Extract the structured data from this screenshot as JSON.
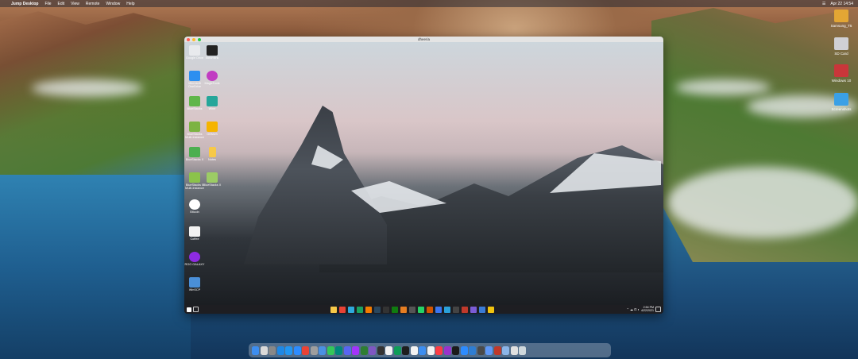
{
  "menubar": {
    "app_name": "Jump Desktop",
    "menus": [
      "File",
      "Edit",
      "View",
      "Remote",
      "Window",
      "Help"
    ],
    "clock": "Apr 22 14:54"
  },
  "desktop_icons": [
    {
      "label": "Samsung_T5",
      "icon": "drive-icon",
      "color": "#e3a634"
    },
    {
      "label": "SD Card",
      "icon": "sd-card-icon",
      "color": "#d0d0d5"
    },
    {
      "label": "Windows 10",
      "icon": "windows-screen-icon",
      "color": "#c9363a"
    },
    {
      "label": "Screenshots",
      "icon": "folder-icon",
      "color": "#3aa0e6"
    }
  ],
  "remote_window": {
    "title": "dheeria",
    "desktop_icons": [
      {
        "label": "Google Drive",
        "icon": "google-drive-icon",
        "color": "#e8eaed"
      },
      {
        "label": "Steamlink",
        "icon": "steamlink-icon",
        "color": "#222"
      },
      {
        "label": "Microsoft OneDrive",
        "icon": "onedrive-icon",
        "color": "#2d8ff0"
      },
      {
        "label": "MagicTools",
        "icon": "magictools-icon",
        "color": "#c13cc2"
      },
      {
        "label": "BlueStacks",
        "icon": "bluestacks-icon",
        "color": "#5fb64a"
      },
      {
        "label": "Wine",
        "icon": "wine-icon",
        "color": "#26a69a"
      },
      {
        "label": "BlueStacks Multi-Instance",
        "icon": "bluestacks-multi-icon",
        "color": "#7cb342"
      },
      {
        "label": "GBNUS",
        "icon": "lightning-icon",
        "color": "#f5b400"
      },
      {
        "label": "BlueStacks X",
        "icon": "bluestacks-x-icon",
        "color": "#4caf50"
      },
      {
        "label": "Notes",
        "icon": "notes-icon",
        "color": "#f7c948"
      },
      {
        "label": "BlueStacks 5 Multi-Instance",
        "icon": "bluestacks5-icon",
        "color": "#8bc34a"
      },
      {
        "label": "BlueStacks X",
        "icon": "bluestacks-cube-icon",
        "color": "#9ccc65"
      },
      {
        "label": "Bitcoin",
        "icon": "bitcoin-icon",
        "color": "#ffffff"
      },
      {
        "label": "Coffee",
        "icon": "coffee-icon",
        "color": "#f2f2f2"
      },
      {
        "label": "ROG GALAXY",
        "icon": "rog-galaxy-icon",
        "color": "#8e2be2"
      },
      {
        "label": "WinSCP",
        "icon": "winscp-icon",
        "color": "#4a8fd8"
      }
    ],
    "taskbar": {
      "apps": [
        {
          "icon": "file-explorer-icon",
          "color": "#f7c948"
        },
        {
          "icon": "chrome-icon",
          "color": "#e94235"
        },
        {
          "icon": "edge-icon",
          "color": "#2ea9dc"
        },
        {
          "icon": "app-icon",
          "color": "#1aa260"
        },
        {
          "icon": "firefox-icon",
          "color": "#f57c00"
        },
        {
          "icon": "steam-icon",
          "color": "#2a475e"
        },
        {
          "icon": "terminal-icon",
          "color": "#333"
        },
        {
          "icon": "xbox-icon",
          "color": "#107c10"
        },
        {
          "icon": "app-icon",
          "color": "#e67e22"
        },
        {
          "icon": "settings-icon",
          "color": "#555"
        },
        {
          "icon": "whatsapp-icon",
          "color": "#25d366"
        },
        {
          "icon": "app-icon",
          "color": "#d35400"
        },
        {
          "icon": "signal-icon",
          "color": "#3a76f0"
        },
        {
          "icon": "telegram-icon",
          "color": "#2aa1da"
        },
        {
          "icon": "app-icon",
          "color": "#444"
        },
        {
          "icon": "app-icon",
          "color": "#c0392b"
        },
        {
          "icon": "visual-studio-icon",
          "color": "#7b5cd6"
        },
        {
          "icon": "app-icon",
          "color": "#3a7bd5"
        },
        {
          "icon": "app-icon",
          "color": "#f1c40f"
        }
      ],
      "time": "2:54 PM",
      "date": "4/22/2021"
    }
  },
  "dock_apps": [
    {
      "icon": "finder-icon",
      "color": "#3d8ef0"
    },
    {
      "icon": "launchpad-icon",
      "color": "#d9d9d9"
    },
    {
      "icon": "calculator-icon",
      "color": "#888"
    },
    {
      "icon": "app-store-icon",
      "color": "#1e88e5"
    },
    {
      "icon": "safari-icon",
      "color": "#2196f3"
    },
    {
      "icon": "zoom-icon",
      "color": "#2d8cff"
    },
    {
      "icon": "chrome-icon",
      "color": "#e94235"
    },
    {
      "icon": "cloud-icon",
      "color": "#9e9e9e"
    },
    {
      "icon": "mail-icon",
      "color": "#4a90e2"
    },
    {
      "icon": "messages-icon",
      "color": "#34c759"
    },
    {
      "icon": "google-meet-icon",
      "color": "#00897b"
    },
    {
      "icon": "discord-icon",
      "color": "#5865f2"
    },
    {
      "icon": "messenger-icon",
      "color": "#a334fa"
    },
    {
      "icon": "chat-icon",
      "color": "#2e7d32"
    },
    {
      "icon": "check-icon",
      "color": "#7e57c2"
    },
    {
      "icon": "terminal-icon",
      "color": "#333"
    },
    {
      "icon": "notion-icon",
      "color": "#f2f2f2"
    },
    {
      "icon": "sheets-icon",
      "color": "#0f9d58"
    },
    {
      "icon": "terminal-icon",
      "color": "#1e1e1e"
    },
    {
      "icon": "pages-icon",
      "color": "#f2f2f2"
    },
    {
      "icon": "app-icon",
      "color": "#3d8ef0"
    },
    {
      "icon": "reminders-icon",
      "color": "#f2f2f2"
    },
    {
      "icon": "music-icon",
      "color": "#fc3c44"
    },
    {
      "icon": "podcasts-icon",
      "color": "#9933cc"
    },
    {
      "icon": "tv-icon",
      "color": "#1b1b1b"
    },
    {
      "icon": "app-icon",
      "color": "#2d8cff"
    },
    {
      "icon": "jump-desktop-icon",
      "color": "#2e7dd2"
    },
    {
      "icon": "app-icon",
      "color": "#4a4a4a"
    },
    {
      "icon": "screen-sharing-icon",
      "color": "#5e97f6"
    },
    {
      "icon": "app-icon",
      "color": "#c0392b"
    },
    {
      "icon": "preview-icon",
      "color": "#8bb5e8"
    },
    {
      "icon": "documents-icon",
      "color": "#e0e0e0"
    },
    {
      "icon": "trash-icon",
      "color": "#cfd8dc"
    }
  ]
}
